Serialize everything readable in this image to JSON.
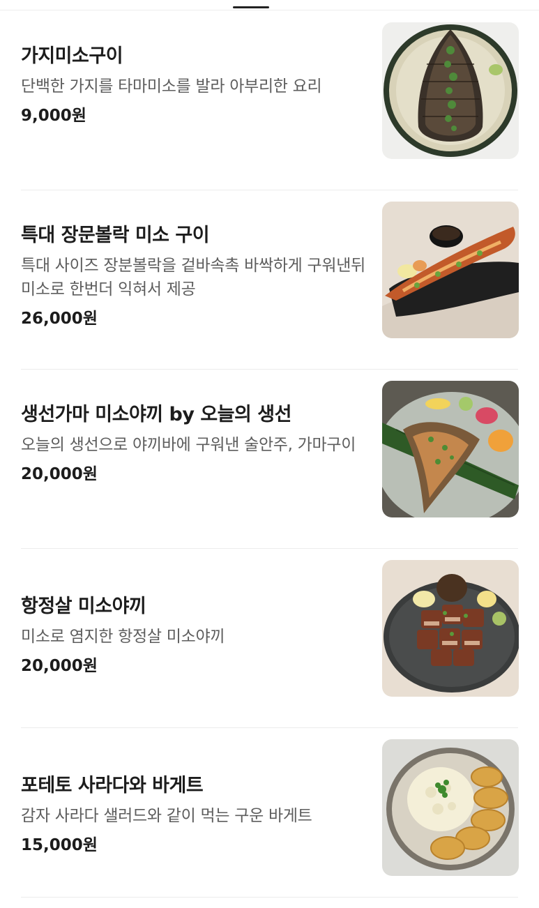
{
  "menu": {
    "items": [
      {
        "name": "가지미소구이",
        "description": "단백한 가지를 타마미소를 발라 아부리한 요리",
        "price": "9,000원",
        "photo_icon": "eggplant-miso-photo"
      },
      {
        "name": "특대 장문볼락 미소 구이",
        "description": "특대 사이즈 장분볼락을 겉바속촉 바싹하게 구워낸뒤 미소로 한번더 익혀서 제공",
        "price": "26,000원",
        "photo_icon": "rockfish-photo"
      },
      {
        "name": "생선가마 미소야끼 by 오늘의 생선",
        "description": "오늘의 생선으로 야끼바에 구워낸 술안주, 가마구이",
        "price": "20,000원",
        "photo_icon": "fish-collar-photo"
      },
      {
        "name": "항정살 미소야끼",
        "description": "미소로 염지한 항정살 미소야끼",
        "price": "20,000원",
        "photo_icon": "pork-jowl-photo"
      },
      {
        "name": "포테토 사라다와 바게트",
        "description": "감자 사라다 샐러드와 같이 먹는 구운 바게트",
        "price": "15,000원",
        "photo_icon": "potato-salad-baguette-photo"
      }
    ]
  },
  "colors": {
    "text_primary": "#1c1c1c",
    "text_secondary": "#5d5d5d",
    "divider": "#ececec",
    "background": "#ffffff"
  }
}
